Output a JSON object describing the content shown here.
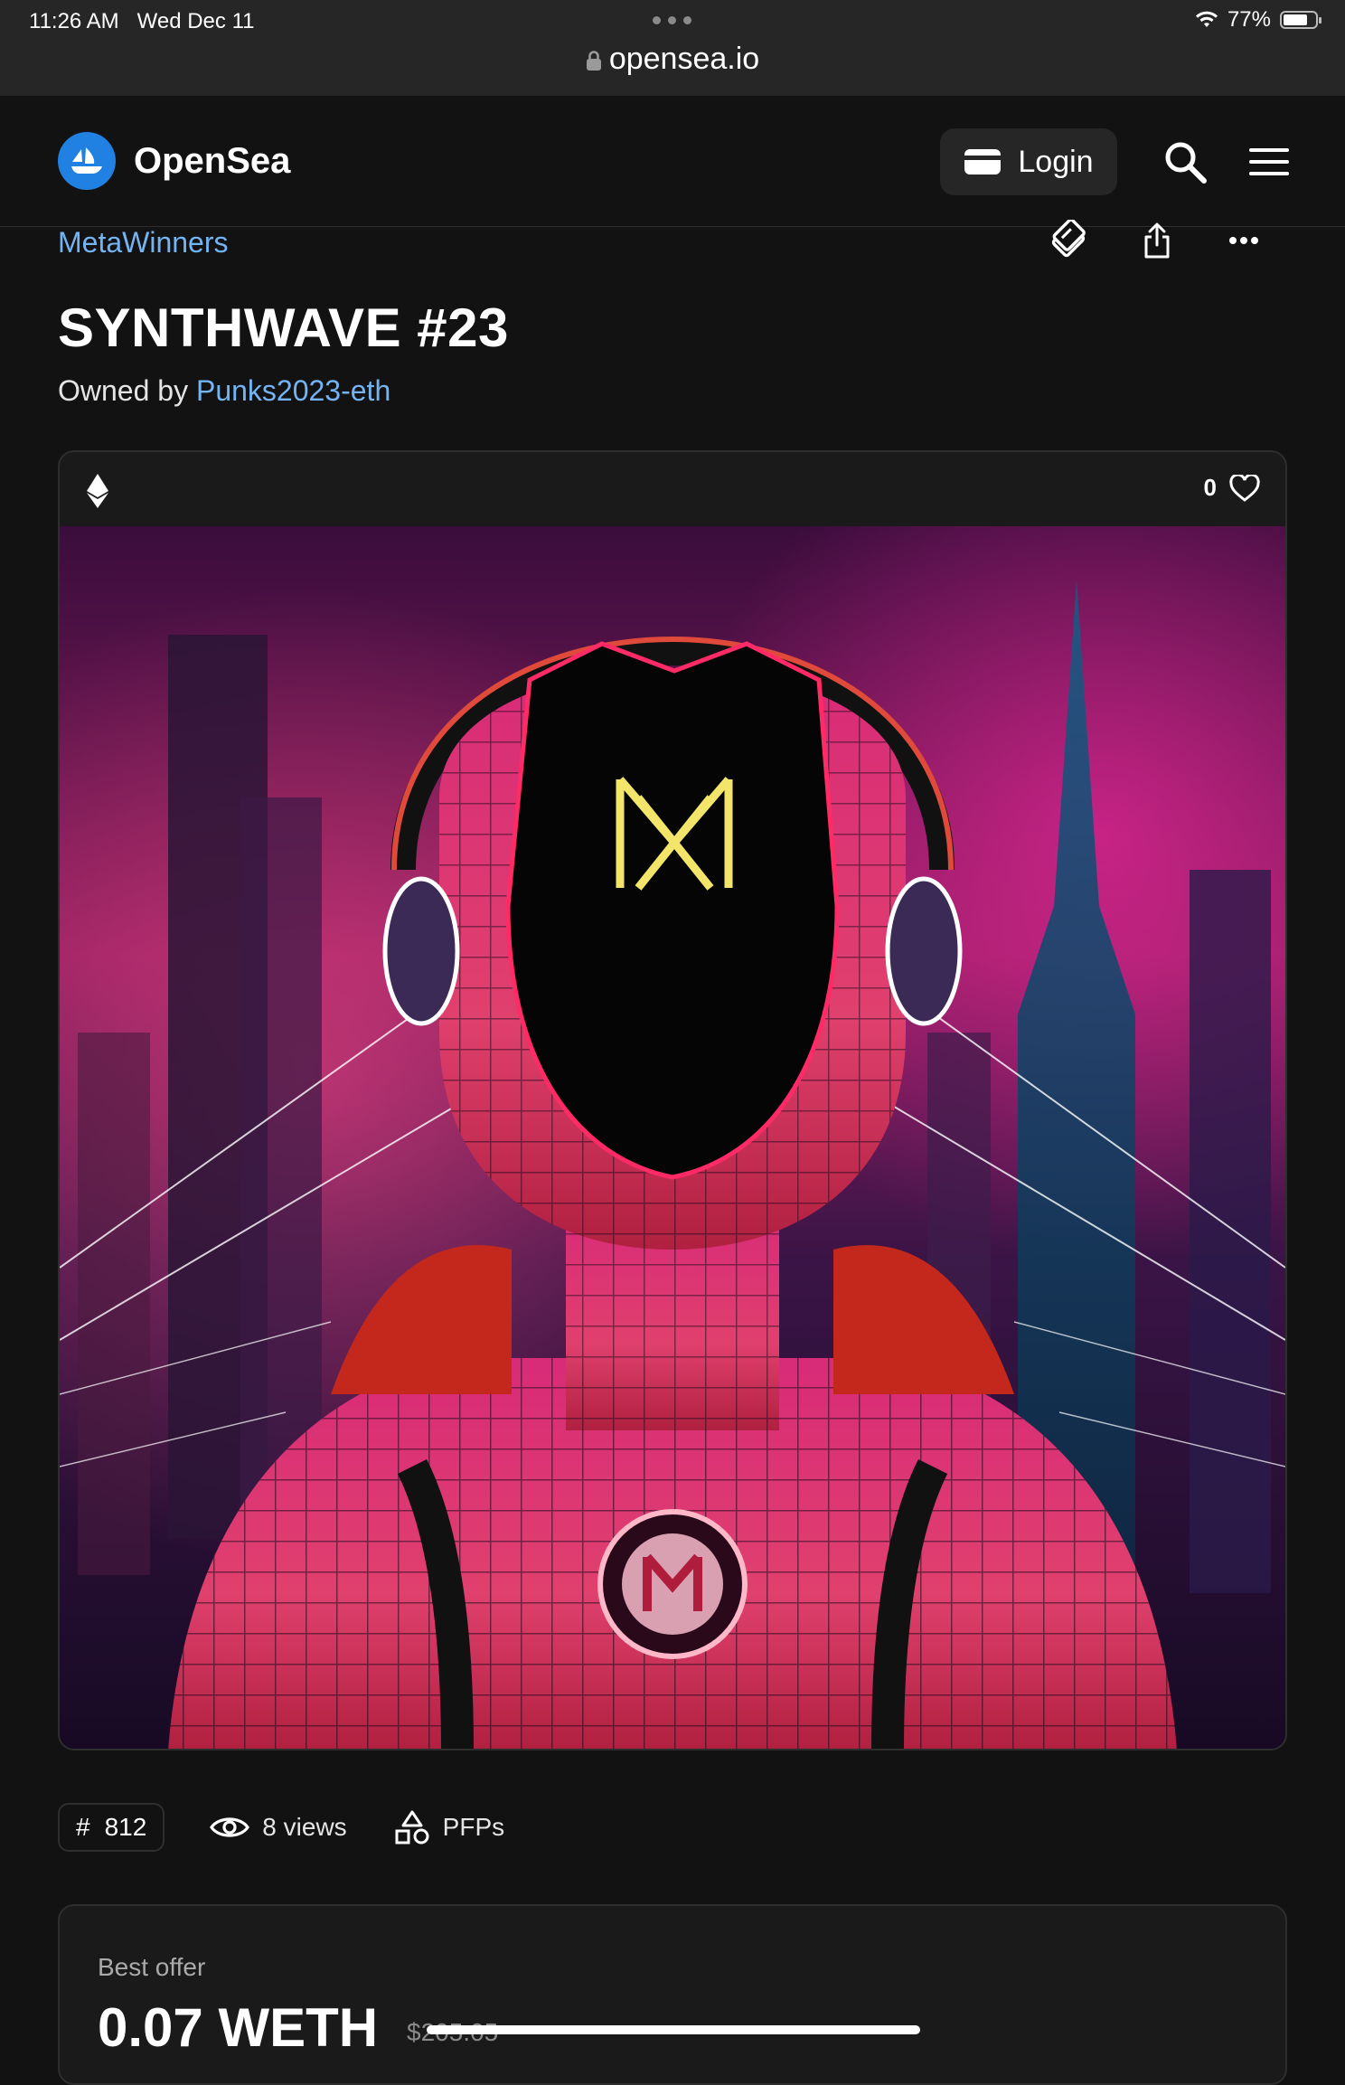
{
  "status_bar": {
    "time": "11:26 AM",
    "date": "Wed Dec 11",
    "battery": "77%",
    "battery_level": 0.77
  },
  "browser": {
    "url": "opensea.io"
  },
  "nav": {
    "brand": "OpenSea",
    "login_label": "Login"
  },
  "item": {
    "collection": "MetaWinners",
    "title": "SYNTHWAVE #23",
    "owned_by_label": "Owned by",
    "owner": "Punks2023-eth",
    "favorites_count": "0"
  },
  "stats": {
    "rank_symbol": "#",
    "rank": "812",
    "views": "8 views",
    "category": "PFPs"
  },
  "offer": {
    "label": "Best offer",
    "price": "0.07 WETH",
    "usd": "$205.05"
  },
  "colors": {
    "accent": "#2081e2",
    "link": "#74b4f2",
    "background": "#121212"
  }
}
